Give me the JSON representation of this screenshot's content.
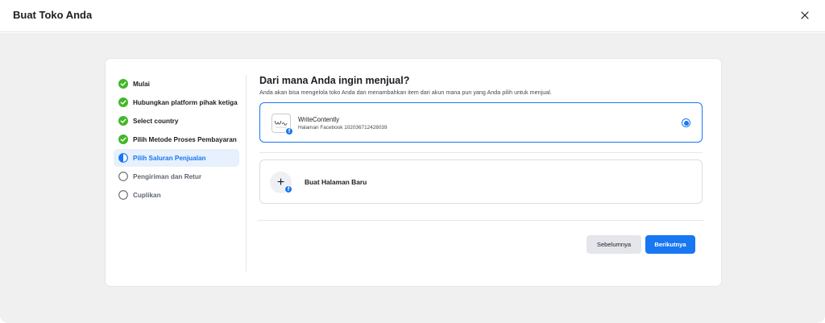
{
  "dialog": {
    "title": "Buat Toko Anda"
  },
  "steps": [
    {
      "label": "Mulai",
      "status": "done"
    },
    {
      "label": "Hubungkan platform pihak ketiga",
      "status": "done"
    },
    {
      "label": "Select country",
      "status": "done"
    },
    {
      "label": "Pilih Metode Proses Pembayaran",
      "status": "done"
    },
    {
      "label": "Pilih Saluran Penjualan",
      "status": "current"
    },
    {
      "label": "Pengiriman dan Retur",
      "status": "pending"
    },
    {
      "label": "Cuplikan",
      "status": "pending"
    }
  ],
  "main": {
    "heading": "Dari mana Anda ingin menjual?",
    "subheading": "Anda akan bisa mengelola toko Anda dan menambahkan item dari akun mana pun yang Anda pilih untuk menjual.",
    "selected_option": {
      "name": "WriteContently",
      "detail": "Halaman Facebook 102036712428039",
      "selected": true
    },
    "new_option": {
      "label": "Buat Halaman Baru"
    },
    "buttons": {
      "prev_label": "Sebelumnya",
      "next_label": "Berikutnya"
    }
  },
  "colors": {
    "accent": "#1877f2",
    "done_green": "#42b72a",
    "background": "#f0f0f0"
  }
}
